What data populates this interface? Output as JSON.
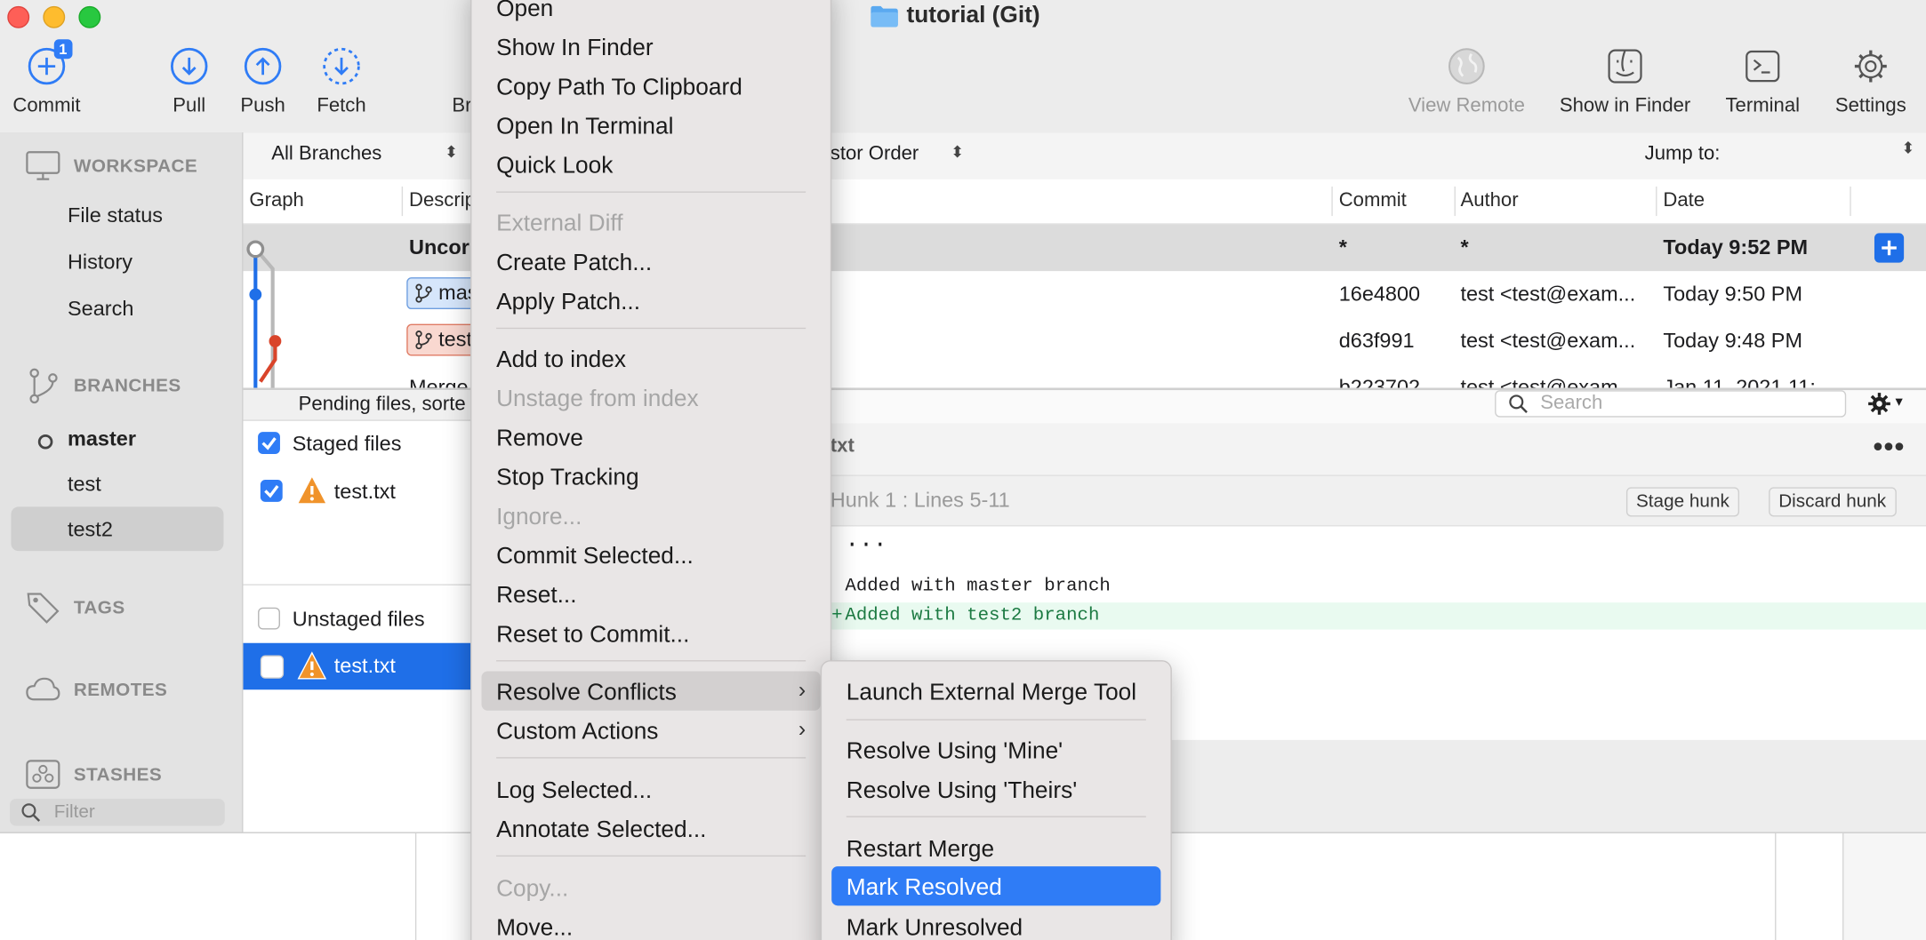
{
  "window": {
    "title": "tutorial (Git)"
  },
  "colors": {
    "accent": "#2f7cf6",
    "warning": "#f0932b",
    "selection_blue": "#1f6fe8",
    "branch_master": "#d6e6fb",
    "branch_test": "#f9d8d0",
    "added_line_bg": "#e9faf0"
  },
  "toolbar": {
    "commit": {
      "label": "Commit",
      "badge": "1",
      "icon": "plus-circle-icon"
    },
    "pull": {
      "label": "Pull",
      "icon": "arrow-down-circle-icon"
    },
    "push": {
      "label": "Push",
      "icon": "arrow-up-circle-icon"
    },
    "fetch": {
      "label": "Fetch",
      "icon": "dashed-arrow-down-circle-icon"
    },
    "branch_partial": "Br",
    "view_remote": {
      "label": "View Remote",
      "icon": "globe-icon"
    },
    "show_in_finder": {
      "label": "Show in Finder",
      "icon": "finder-icon"
    },
    "terminal": {
      "label": "Terminal",
      "icon": "terminal-icon"
    },
    "settings": {
      "label": "Settings",
      "icon": "gear-icon"
    }
  },
  "sidebar": {
    "workspace": {
      "title": "WORKSPACE",
      "items": [
        "File status",
        "History",
        "Search"
      ]
    },
    "branches": {
      "title": "BRANCHES",
      "items": [
        "master",
        "test",
        "test2"
      ],
      "current": "master",
      "selected": "test2"
    },
    "tags": {
      "title": "TAGS"
    },
    "remotes": {
      "title": "REMOTES"
    },
    "stashes": {
      "title": "STASHES"
    },
    "filter_placeholder": "Filter"
  },
  "history": {
    "branch_filter": "All Branches",
    "order_partial": "stor Order",
    "jump_to": "Jump to:",
    "columns": {
      "graph": "Graph",
      "description": "Descrip",
      "commit": "Commit",
      "author": "Author",
      "date": "Date"
    },
    "rows": [
      {
        "description": "Uncor",
        "commit": "*",
        "author": "*",
        "date": "Today 9:52 PM"
      },
      {
        "branch": "mas",
        "commit": "16e4800",
        "author": "test <test@exam...",
        "date": "Today 9:50 PM"
      },
      {
        "branch": "test",
        "commit": "d63f991",
        "author": "test <test@exam...",
        "date": "Today 9:48 PM"
      },
      {
        "description": "Merge",
        "commit": "b223702",
        "author": "test <test@exam...",
        "date": "Jan 11, 2021 11:"
      }
    ]
  },
  "files": {
    "pending_header": "Pending files, sorte",
    "staged_label": "Staged files",
    "unstaged_label": "Unstaged files",
    "staged_file": "test.txt",
    "unstaged_file": "test.txt"
  },
  "diff": {
    "file_name_partial": "txt",
    "search_placeholder": "Search",
    "hunk_label": "Hunk 1 : Lines 5-11",
    "stage_hunk": "Stage hunk",
    "discard_hunk": "Discard hunk",
    "lines": [
      {
        "prefix": "",
        "text": "..."
      },
      {
        "prefix": "",
        "text": ""
      },
      {
        "prefix": "",
        "text": "Added with master branch"
      },
      {
        "prefix": "+",
        "text": "Added with test2 branch"
      }
    ]
  },
  "context_menu": {
    "items": [
      {
        "label": "Open",
        "disabled": false
      },
      {
        "label": "Show In Finder",
        "disabled": false
      },
      {
        "label": "Copy Path To Clipboard",
        "disabled": false
      },
      {
        "label": "Open In Terminal",
        "disabled": false
      },
      {
        "label": "Quick Look",
        "disabled": false
      },
      {
        "label": "External Diff",
        "disabled": true
      },
      {
        "label": "Create Patch...",
        "disabled": false
      },
      {
        "label": "Apply Patch...",
        "disabled": false
      },
      {
        "label": "Add to index",
        "disabled": false
      },
      {
        "label": "Unstage from index",
        "disabled": true
      },
      {
        "label": "Remove",
        "disabled": false
      },
      {
        "label": "Stop Tracking",
        "disabled": false
      },
      {
        "label": "Ignore...",
        "disabled": true
      },
      {
        "label": "Commit Selected...",
        "disabled": false
      },
      {
        "label": "Reset...",
        "disabled": false
      },
      {
        "label": "Reset to Commit...",
        "disabled": false
      },
      {
        "label": "Resolve Conflicts",
        "disabled": false,
        "submenu": true,
        "highlighted": true
      },
      {
        "label": "Custom Actions",
        "disabled": false,
        "submenu": true
      },
      {
        "label": "Log Selected...",
        "disabled": false
      },
      {
        "label": "Annotate Selected...",
        "disabled": false
      },
      {
        "label": "Copy...",
        "disabled": true
      },
      {
        "label": "Move...",
        "disabled": false
      }
    ]
  },
  "submenu": {
    "items": [
      {
        "label": "Launch External Merge Tool"
      },
      {
        "label": "Resolve Using 'Mine'"
      },
      {
        "label": "Resolve Using 'Theirs'"
      },
      {
        "label": "Restart Merge"
      },
      {
        "label": "Mark Resolved",
        "highlighted": true
      },
      {
        "label": "Mark Unresolved"
      }
    ]
  }
}
